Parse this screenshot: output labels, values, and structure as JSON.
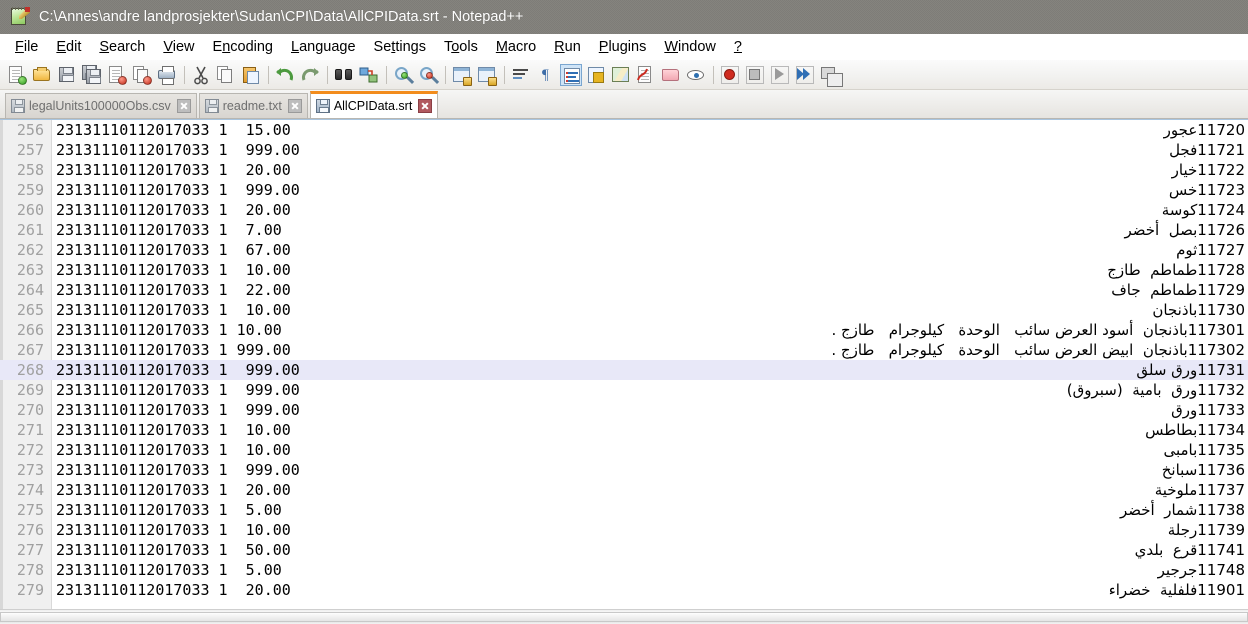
{
  "window": {
    "title": "C:\\Annes\\andre landprosjekter\\Sudan\\CPI\\Data\\AllCPIData.srt - Notepad++",
    "app_icon": "notepad-plus-plus-icon",
    "titlebar_color": "#7b7974"
  },
  "menubar": {
    "items": [
      {
        "label": "File",
        "accel": "F"
      },
      {
        "label": "Edit",
        "accel": "E"
      },
      {
        "label": "Search",
        "accel": "S"
      },
      {
        "label": "View",
        "accel": "V"
      },
      {
        "label": "Encoding",
        "accel": "n"
      },
      {
        "label": "Language",
        "accel": "L"
      },
      {
        "label": "Settings",
        "accel": "t"
      },
      {
        "label": "Tools",
        "accel": "o"
      },
      {
        "label": "Macro",
        "accel": "M"
      },
      {
        "label": "Run",
        "accel": "R"
      },
      {
        "label": "Plugins",
        "accel": "P"
      },
      {
        "label": "Window",
        "accel": "W"
      },
      {
        "label": "?",
        "accel": "?"
      }
    ]
  },
  "toolbar": {
    "buttons": [
      {
        "name": "new-file-icon",
        "tip": "New"
      },
      {
        "name": "open-file-icon",
        "tip": "Open"
      },
      {
        "name": "save-icon",
        "tip": "Save"
      },
      {
        "name": "save-all-icon",
        "tip": "Save All"
      },
      {
        "name": "close-file-icon",
        "tip": "Close"
      },
      {
        "name": "close-all-icon",
        "tip": "Close All"
      },
      {
        "name": "print-icon",
        "tip": "Print"
      },
      {
        "name": "separator",
        "tip": ""
      },
      {
        "name": "cut-icon",
        "tip": "Cut"
      },
      {
        "name": "copy-icon",
        "tip": "Copy"
      },
      {
        "name": "paste-icon",
        "tip": "Paste"
      },
      {
        "name": "separator",
        "tip": ""
      },
      {
        "name": "undo-icon",
        "tip": "Undo"
      },
      {
        "name": "redo-icon",
        "tip": "Redo"
      },
      {
        "name": "separator",
        "tip": ""
      },
      {
        "name": "find-icon",
        "tip": "Find"
      },
      {
        "name": "replace-icon",
        "tip": "Replace"
      },
      {
        "name": "separator",
        "tip": ""
      },
      {
        "name": "zoom-in-icon",
        "tip": "Zoom In"
      },
      {
        "name": "zoom-out-icon",
        "tip": "Zoom Out"
      },
      {
        "name": "separator",
        "tip": ""
      },
      {
        "name": "sync-vertical-scroll-icon",
        "tip": "Synchronize Vertical Scrolling"
      },
      {
        "name": "sync-horizontal-scroll-icon",
        "tip": "Synchronize Horizontal Scrolling"
      },
      {
        "name": "separator",
        "tip": ""
      },
      {
        "name": "word-wrap-icon",
        "tip": "Word wrap"
      },
      {
        "name": "show-all-characters-icon",
        "tip": "Show All Characters"
      },
      {
        "name": "show-indent-guide-icon",
        "tip": "Show Indent Guide",
        "selected": true
      },
      {
        "name": "user-defined-language-icon",
        "tip": "User-Defined Dialogue"
      },
      {
        "name": "document-map-icon",
        "tip": "Document Map"
      },
      {
        "name": "function-list-icon",
        "tip": "Function List"
      },
      {
        "name": "folder-as-workspace-icon",
        "tip": "Folder as Workspace"
      },
      {
        "name": "monitoring-icon",
        "tip": "Monitoring"
      },
      {
        "name": "separator",
        "tip": ""
      },
      {
        "name": "record-macro-icon",
        "tip": "Start Recording"
      },
      {
        "name": "stop-recording-icon",
        "tip": "Stop Recording"
      },
      {
        "name": "play-macro-icon",
        "tip": "Playback"
      },
      {
        "name": "run-macro-multiple-icon",
        "tip": "Run a Macro Multiple Times"
      },
      {
        "name": "save-macro-icon",
        "tip": "Save Current Recorded Macro"
      }
    ]
  },
  "tabs": [
    {
      "label": "legalUnits100000Obs.csv",
      "active": false,
      "icon": "saved-file-icon"
    },
    {
      "label": "readme.txt",
      "active": false,
      "icon": "saved-file-icon"
    },
    {
      "label": "AllCPIData.srt",
      "active": true,
      "icon": "saved-file-icon"
    }
  ],
  "editor": {
    "current_line": 268,
    "current_line_color": "#e8e8f8",
    "gutter_color": "#f0f0f0",
    "lines": [
      {
        "n": "256",
        "code": "23131110112017033 1  15.00",
        "arabic": "11720عجور"
      },
      {
        "n": "257",
        "code": "23131110112017033 1  999.00",
        "arabic": "11721فجل"
      },
      {
        "n": "258",
        "code": "23131110112017033 1  20.00",
        "arabic": "11722خيار"
      },
      {
        "n": "259",
        "code": "23131110112017033 1  999.00",
        "arabic": "11723خس"
      },
      {
        "n": "260",
        "code": "23131110112017033 1  20.00",
        "arabic": "11724كوسة"
      },
      {
        "n": "261",
        "code": "23131110112017033 1  7.00",
        "arabic": "11726بصل  أخضر"
      },
      {
        "n": "262",
        "code": "23131110112017033 1  67.00",
        "arabic": "11727ثوم"
      },
      {
        "n": "263",
        "code": "23131110112017033 1  10.00",
        "arabic": "11728طماطم  طازج"
      },
      {
        "n": "264",
        "code": "23131110112017033 1  22.00",
        "arabic": "11729طماطم  جاف"
      },
      {
        "n": "265",
        "code": "23131110112017033 1  10.00",
        "arabic": "11730باذنجان"
      },
      {
        "n": "266",
        "code": "23131110112017033 1 10.00",
        "arabic": "117301باذنجان  أسود العرض سائب   الوحدة   كيلوجرام   طازج ."
      },
      {
        "n": "267",
        "code": "23131110112017033 1 999.00",
        "arabic": "117302باذنجان  ابيض العرض سائب   الوحدة   كيلوجرام   طازج ."
      },
      {
        "n": "268",
        "code": "23131110112017033 1  999.00",
        "arabic": "11731ورق سلق",
        "current": true
      },
      {
        "n": "269",
        "code": "23131110112017033 1  999.00",
        "arabic": "11732ورق  بامية  (سبروق)"
      },
      {
        "n": "270",
        "code": "23131110112017033 1  999.00",
        "arabic": "11733ورق"
      },
      {
        "n": "271",
        "code": "23131110112017033 1  10.00",
        "arabic": "11734بطاطس"
      },
      {
        "n": "272",
        "code": "23131110112017033 1  10.00",
        "arabic": "11735بامبى"
      },
      {
        "n": "273",
        "code": "23131110112017033 1  999.00",
        "arabic": "11736سبانخ"
      },
      {
        "n": "274",
        "code": "23131110112017033 1  20.00",
        "arabic": "11737ملوخية"
      },
      {
        "n": "275",
        "code": "23131110112017033 1  5.00",
        "arabic": "11738شمار  أخضر"
      },
      {
        "n": "276",
        "code": "23131110112017033 1  10.00",
        "arabic": "11739رجلة"
      },
      {
        "n": "277",
        "code": "23131110112017033 1  50.00",
        "arabic": "11741قرع  بلدي"
      },
      {
        "n": "278",
        "code": "23131110112017033 1  5.00",
        "arabic": "11748جرجير"
      },
      {
        "n": "279",
        "code": "23131110112017033 1  20.00",
        "arabic": "11901فلفلية  خضراء"
      }
    ]
  },
  "scrollbar": {
    "orientation": "horizontal",
    "position": "bottom"
  }
}
